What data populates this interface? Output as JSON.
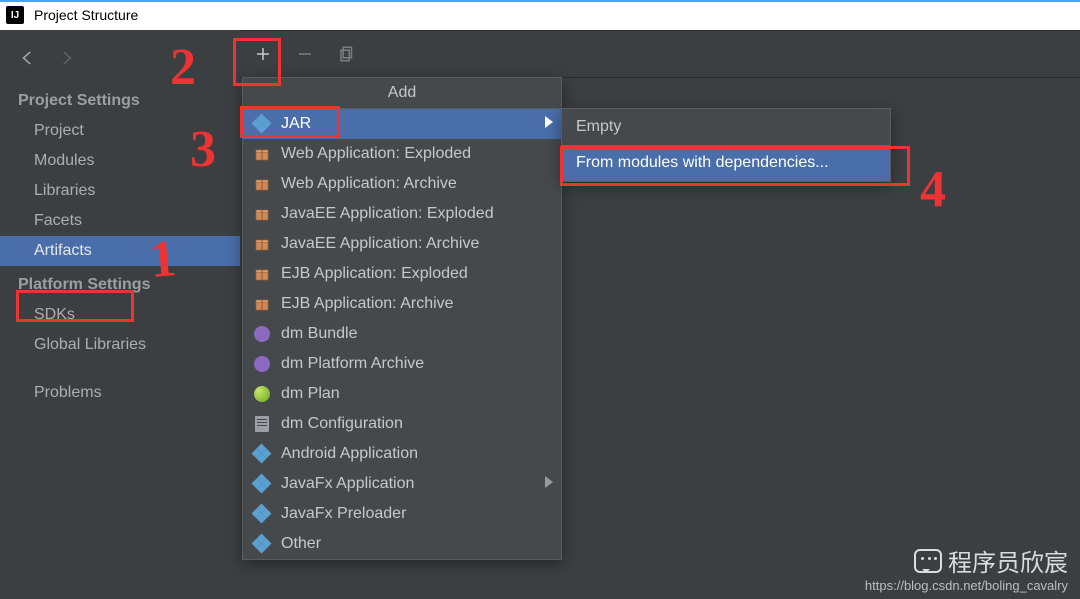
{
  "titlebar": {
    "title": "Project Structure"
  },
  "sidebar": {
    "section1": "Project Settings",
    "section2": "Platform Settings",
    "items1": [
      {
        "label": "Project"
      },
      {
        "label": "Modules"
      },
      {
        "label": "Libraries"
      },
      {
        "label": "Facets"
      },
      {
        "label": "Artifacts"
      }
    ],
    "items2": [
      {
        "label": "SDKs"
      },
      {
        "label": "Global Libraries"
      }
    ],
    "problems": "Problems"
  },
  "dropdown": {
    "title": "Add",
    "items": [
      {
        "label": "JAR",
        "icon": "diamond-grid",
        "hl": true,
        "sub": true
      },
      {
        "label": "Web Application: Exploded",
        "icon": "gift"
      },
      {
        "label": "Web Application: Archive",
        "icon": "gift"
      },
      {
        "label": "JavaEE Application: Exploded",
        "icon": "gift"
      },
      {
        "label": "JavaEE Application: Archive",
        "icon": "gift"
      },
      {
        "label": "EJB Application: Exploded",
        "icon": "gift"
      },
      {
        "label": "EJB Application: Archive",
        "icon": "gift"
      },
      {
        "label": "dm Bundle",
        "icon": "bundle"
      },
      {
        "label": "dm Platform Archive",
        "icon": "bundle"
      },
      {
        "label": "dm Plan",
        "icon": "globe"
      },
      {
        "label": "dm Configuration",
        "icon": "doc"
      },
      {
        "label": "Android Application",
        "icon": "diamond-grid"
      },
      {
        "label": "JavaFx Application",
        "icon": "diamond-grid",
        "sub": true
      },
      {
        "label": "JavaFx Preloader",
        "icon": "diamond-grid"
      },
      {
        "label": "Other",
        "icon": "diamond-grid"
      }
    ]
  },
  "submenu": {
    "items": [
      {
        "label": "Empty"
      },
      {
        "label": "From modules with dependencies...",
        "hl": true
      }
    ]
  },
  "annotations": {
    "n1": "1",
    "n2": "2",
    "n3": "3",
    "n4": "4"
  },
  "watermark": {
    "line1": "程序员欣宸",
    "line2": "https://blog.csdn.net/boling_cavalry"
  }
}
